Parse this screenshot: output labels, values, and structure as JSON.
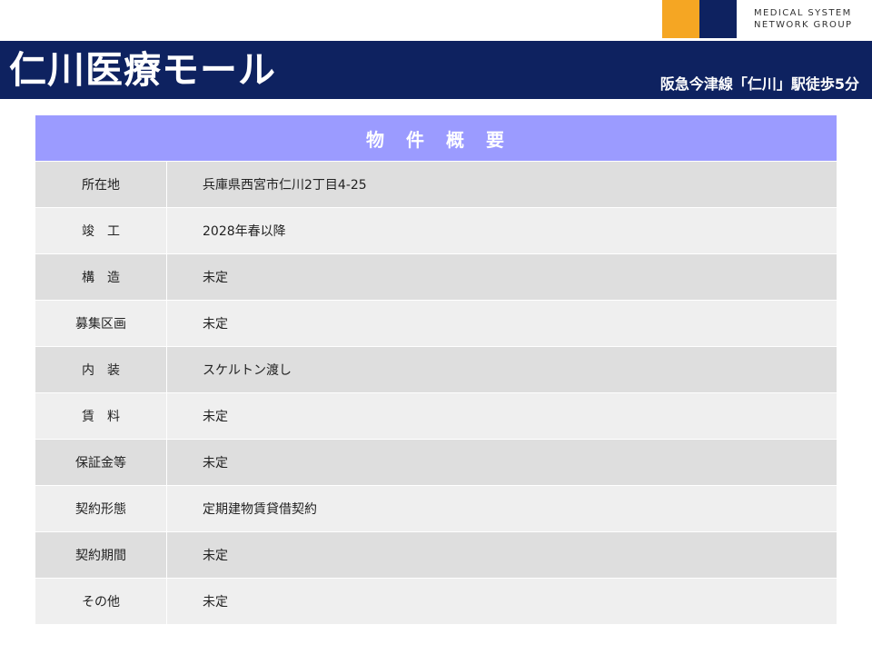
{
  "logo": {
    "line1": "MEDICAL SYSTEM",
    "line2": "NETWORK GROUP",
    "colors": {
      "orange": "#f5a623",
      "navy": "#0e2260"
    }
  },
  "header": {
    "title": "仁川医療モール",
    "access": "阪急今津線「仁川」駅徒歩5分",
    "background": "#0e2260"
  },
  "table": {
    "heading": "物　件　概　要",
    "heading_color": "#9b9bff",
    "rows": [
      {
        "label": "所在地",
        "value": "兵庫県西宮市仁川2丁目4-25"
      },
      {
        "label": "竣　工",
        "value": "2028年春以降"
      },
      {
        "label": "構　造",
        "value": "未定"
      },
      {
        "label": "募集区画",
        "value": "未定"
      },
      {
        "label": "内　装",
        "value": "スケルトン渡し"
      },
      {
        "label": "賃　料",
        "value": "未定"
      },
      {
        "label": "保証金等",
        "value": "未定"
      },
      {
        "label": "契約形態",
        "value": "定期建物賃貸借契約"
      },
      {
        "label": "契約期間",
        "value": "未定"
      },
      {
        "label": "その他",
        "value": "未定"
      }
    ]
  }
}
